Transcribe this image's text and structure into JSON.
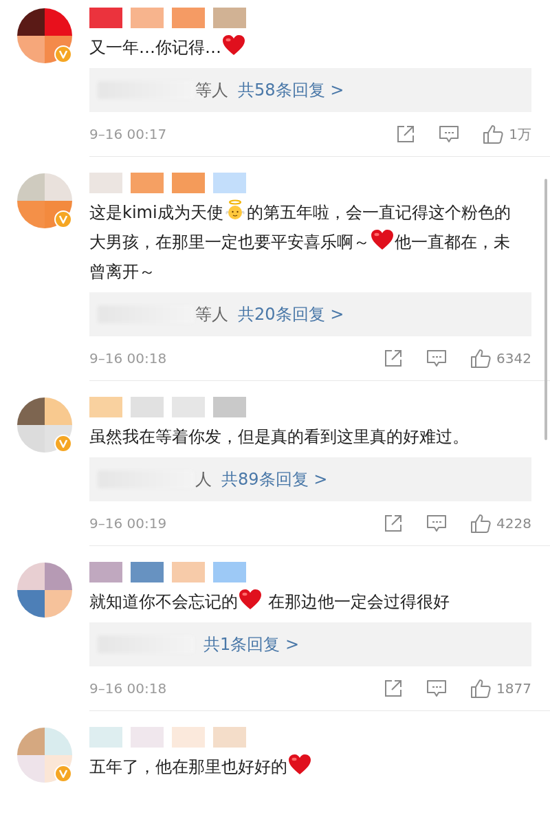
{
  "comments": [
    {
      "verified": true,
      "content": [
        {
          "kind": "text",
          "text": "又一年…你记得…"
        },
        {
          "kind": "heart"
        }
      ],
      "replies": {
        "others": "等人",
        "link": "共58条回复 >"
      },
      "time": "9–16 00:17",
      "likes": "1万"
    },
    {
      "verified": true,
      "content": [
        {
          "kind": "text",
          "text": "这是kimi成为天使"
        },
        {
          "kind": "angel"
        },
        {
          "kind": "text",
          "text": "的第五年啦，会一直记得这个粉色的大男孩，在那里一定也要平安喜乐啊～"
        },
        {
          "kind": "heart"
        },
        {
          "kind": "text",
          "text": "他一直都在，未曾离开～"
        }
      ],
      "replies": {
        "others": "等人",
        "link": "共20条回复 >"
      },
      "time": "9–16 00:18",
      "likes": "6342"
    },
    {
      "verified": true,
      "content": [
        {
          "kind": "text",
          "text": "虽然我在等着你发，但是真的看到这里真的好难过。"
        }
      ],
      "replies": {
        "others": "人",
        "link": "共89条回复 >"
      },
      "time": "9–16 00:19",
      "likes": "4228"
    },
    {
      "verified": false,
      "content": [
        {
          "kind": "text",
          "text": "就知道你不会忘记的"
        },
        {
          "kind": "heart"
        },
        {
          "kind": "text",
          "text": " 在那边他一定会过得很好"
        }
      ],
      "replies": {
        "link": "共1条回复 >"
      },
      "time": "9–16 00:18",
      "likes": "1877"
    },
    {
      "verified": true,
      "content": [
        {
          "kind": "text",
          "text": "五年了，他在那里也好好的"
        },
        {
          "kind": "heart"
        }
      ]
    }
  ]
}
